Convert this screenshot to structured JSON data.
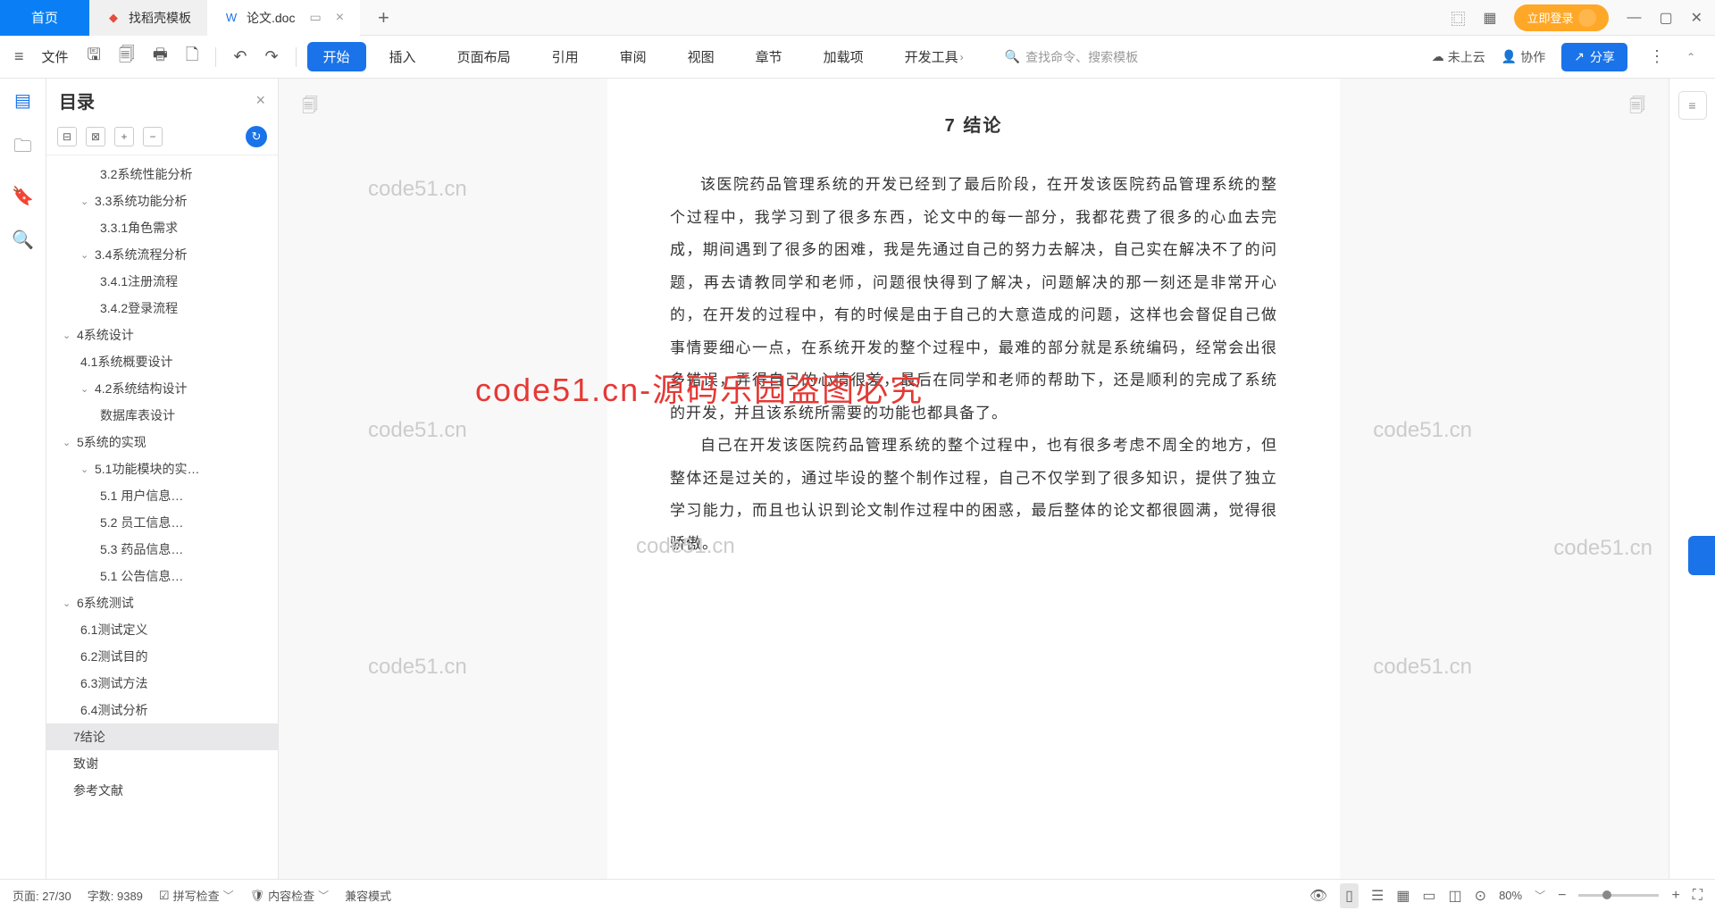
{
  "tabs": {
    "home": "首页",
    "t1": "找稻壳模板",
    "t2": "论文.doc",
    "plus": "+"
  },
  "titlebar": {
    "login": "立即登录"
  },
  "menu": {
    "file": "文件",
    "items": [
      "开始",
      "插入",
      "页面布局",
      "引用",
      "审阅",
      "视图",
      "章节",
      "加载项",
      "开发工具"
    ],
    "search_ph": "查找命令、搜索模板",
    "cloud": "未上云",
    "collab": "协作",
    "share": "分享"
  },
  "sidepanel": {
    "title": "目录",
    "toc": [
      {
        "lvl": 3,
        "txt": "3.2系统性能分析"
      },
      {
        "lvl": 2,
        "caret": true,
        "txt": "3.3系统功能分析"
      },
      {
        "lvl": 3,
        "txt": "3.3.1角色需求"
      },
      {
        "lvl": 2,
        "caret": true,
        "txt": "3.4系统流程分析"
      },
      {
        "lvl": 3,
        "txt": "3.4.1注册流程"
      },
      {
        "lvl": 3,
        "txt": "3.4.2登录流程"
      },
      {
        "lvl": 1,
        "caret": true,
        "txt": "4系统设计"
      },
      {
        "lvl": 2,
        "txt": "4.1系统概要设计"
      },
      {
        "lvl": 2,
        "caret": true,
        "txt": "4.2系统结构设计"
      },
      {
        "lvl": 3,
        "txt": "数据库表设计"
      },
      {
        "lvl": 1,
        "caret": true,
        "txt": "5系统的实现"
      },
      {
        "lvl": 2,
        "caret": true,
        "txt": "5.1功能模块的实…"
      },
      {
        "lvl": 3,
        "txt": "5.1 用户信息…"
      },
      {
        "lvl": 3,
        "txt": "5.2 员工信息…"
      },
      {
        "lvl": 3,
        "txt": "5.3 药品信息…"
      },
      {
        "lvl": 3,
        "txt": "5.1 公告信息…"
      },
      {
        "lvl": 1,
        "caret": true,
        "txt": "6系统测试"
      },
      {
        "lvl": 2,
        "txt": "6.1测试定义"
      },
      {
        "lvl": 2,
        "txt": "6.2测试目的"
      },
      {
        "lvl": 2,
        "txt": "6.3测试方法"
      },
      {
        "lvl": 2,
        "txt": "6.4测试分析"
      },
      {
        "lvl": "1b",
        "sel": true,
        "txt": "7结论"
      },
      {
        "lvl": "1b",
        "txt": "致谢"
      },
      {
        "lvl": "1b",
        "txt": "参考文献"
      }
    ]
  },
  "doc": {
    "heading": "7  结论",
    "p1": "该医院药品管理系统的开发已经到了最后阶段，在开发该医院药品管理系统的整个过程中，我学习到了很多东西，论文中的每一部分，我都花费了很多的心血去完成，期间遇到了很多的困难，我是先通过自己的努力去解决，自己实在解决不了的问题，再去请教同学和老师，问题很快得到了解决，问题解决的那一刻还是非常开心的，在开发的过程中，有的时候是由于自己的大意造成的问题，这样也会督促自己做事情要细心一点，在系统开发的整个过程中，最难的部分就是系统编码，经常会出很多错误，弄得自己的心情很差，最后在同学和老师的帮助下，还是顺利的完成了系统的开发，并且该系统所需要的功能也都具备了。",
    "p2": "自己在开发该医院药品管理系统的整个过程中，也有很多考虑不周全的地方，但整体还是过关的，通过毕设的整个制作过程，自己不仅学到了很多知识，提供了独立学习能力，而且也认识到论文制作过程中的困惑，最后整体的论文都很圆满，觉得很骄傲。"
  },
  "watermarks": {
    "grey": "code51.cn",
    "red": "code51.cn-源码乐园盗图必究"
  },
  "status": {
    "page": "页面: 27/30",
    "words": "字数: 9389",
    "spell": "拼写检查",
    "content": "内容检查",
    "compat": "兼容模式",
    "zoom": "80%"
  }
}
